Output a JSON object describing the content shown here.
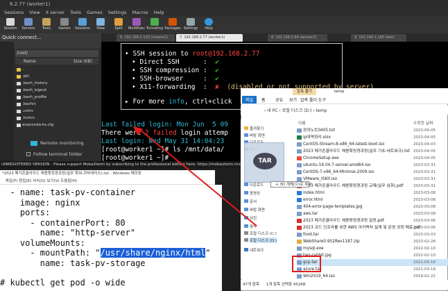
{
  "moba": {
    "title": "6.2.77 (worker1)",
    "menu": [
      "Sessions",
      "View",
      "X server",
      "Tools",
      "Games",
      "Settings",
      "Macros",
      "Help"
    ],
    "toolbar": [
      "Session",
      "Servers",
      "Tools",
      "Games",
      "Sessions",
      "View",
      "Split",
      "MultiExec",
      "Tunneling",
      "Packages",
      "Settings",
      "Help"
    ],
    "quick_connect": "Quick connect...",
    "path": "/root/",
    "col_name": "Name",
    "col_size": "Size (KB)",
    "files": [
      "..",
      ".pki",
      ".bash_history",
      ".bash_logout",
      ".bash_profile",
      ".bashrc",
      ".cshrc",
      ".tcshrc",
      "anaconda-ks.cfg"
    ],
    "remote_monitoring": "Remote monitoring",
    "follow_terminal": "Follow terminal folder",
    "tabs": [
      "6. 192.168.2.103 (master1)",
      "7. 192.168.2.77 (worker1)",
      "8. 192.168.2.84 (worker2)",
      "9. 192.168.1.180 (test)"
    ],
    "register": "UNREGISTERED VERSION - Please support MobaXterm by subscribing to the professional edition here: https://mobaxterm.mobatek.net"
  },
  "terminal": {
    "ssh_line": "SSH session to ",
    "ssh_host": "root@192.168.2.77",
    "direct_ssh": "Direct SSH",
    "ssh_compression": "SSH compression",
    "ssh_browser": "SSH-browser",
    "x11": "X11-forwarding",
    "x11_note": "(disabled or not supported by server)",
    "more_info_pre": "For more ",
    "more_info_word": "info",
    "more_info_post": ", ctrl+click",
    "failed_login": "Last failed login: Mon Jun  5 09",
    "there_were": "There were ",
    "failed_count": "2",
    "failed_word": " failed",
    "failed_rest": " login attemp",
    "last_login": "Last login: Wed May 31 14:04:23",
    "prompt1": "[root@worker1 ~]# ls /mnt/data/",
    "prompt2": "[root@worker1 ~]# "
  },
  "notepad": {
    "title": "*2023 메가존클라우드 채용확정경과정(실무 확워-쿠버네티스).txt - Windows 메모장",
    "menu": "파일(F)  편집(E)  서식(O)  보기(V)  도움말(H)",
    "lines": [
      "  - name: task-pv-container",
      "    image: nginx",
      "    ports:",
      "      - containerPort: 80",
      "        name: \"http-server\"",
      "    volumeMounts:",
      "      - mountPath: \"",
      "        name: task-pv-storage",
      "",
      "# kubectl get pod -o wide"
    ],
    "mount_path": "/usr/share/nginx/html",
    "mount_close": "\""
  },
  "explorer": {
    "title": "temp",
    "ribbon": [
      "파일",
      "홈",
      "공유",
      "보기"
    ],
    "ribbon_tool": "압축 풀기",
    "ribbon_tool2": "압축 폴더 도구",
    "address": "› 내 PC › 로컬 디스크 (D:) › temp",
    "col_name": "이름",
    "col_date": "수정한 날짜",
    "nav": [
      "즐겨찾기",
      "바탕 화면",
      "다운로드",
      "문서",
      "사진",
      "다운로드",
      "동영상",
      "문서",
      "바탕 화면",
      "사진",
      "음악",
      "로컬 디스크 (C:)",
      "로컬 디스크 (D:)",
      "네트워크"
    ],
    "files": [
      {
        "name": "정의노트0405.txt",
        "date": "2023-04-05"
      },
      {
        "name": "ip대역정리.xlsx",
        "date": "2023-04-05"
      },
      {
        "name": "CentOS-Stream-8-x86_64-latest-boot.iso",
        "date": "2023-04-03"
      },
      {
        "name": "2023 메가존클라우드 채용확정경과정(실무 기초-네트워크).txt",
        "date": "2023-04-05"
      },
      {
        "name": "ChromeSetup.exe",
        "date": "2023-04-05"
      },
      {
        "name": "ubuntu-16.04.7-server-amd64.iso",
        "date": "2023-03-31"
      },
      {
        "name": "CentOS-7-x86_64-Minimal-2009.iso",
        "date": "2023-03-31"
      },
      {
        "name": "VMware_ISKit.iso",
        "date": "2023-03-31"
      },
      {
        "name": "2023 메가존클라우드 채용확정경과정 교재(실무 심화).pdf",
        "date": "2023-03-31"
      },
      {
        "name": "index.html",
        "date": "2023-03-08"
      },
      {
        "name": "error.html",
        "date": "2023-03-08"
      },
      {
        "name": "404-error-page-templates.jpg",
        "date": "2023-03-08"
      },
      {
        "name": "aws.tar",
        "date": "2023-03-08"
      },
      {
        "name": "2023 메가존클라우드 채용확정경과정 일정.pdf",
        "date": "2023-03-06"
      },
      {
        "name": "2023 코드 인프라를 위한 AWS 아키텍처 설계 및 운영 과정 매료.pdf",
        "date": "2023-03-06"
      },
      {
        "name": "food.tar",
        "date": "2023-03-03"
      },
      {
        "name": "WebShare0.952Rev1187.zip",
        "date": "2023-02-28"
      },
      {
        "name": "mysql.exe",
        "date": "2022-02-10"
      },
      {
        "name": "two-rabbit.jpg",
        "date": "2022-02-10"
      },
      {
        "name": "gcp.tar",
        "date": "2021-03-19"
      },
      {
        "name": "azure.tar",
        "date": "2021-03-19"
      },
      {
        "name": "Win2019_64.iso",
        "date": "2019-02-22"
      }
    ],
    "status_count": "47개 항목",
    "status_sel": "1개 항목 선택함 452KB",
    "tar_label": "TAR",
    "copy_tip": "+ 3D 개체(으)로 복사"
  }
}
